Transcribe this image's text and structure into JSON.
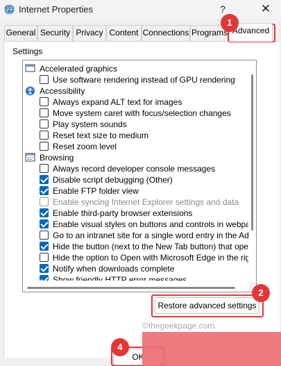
{
  "window": {
    "title": "Internet Properties",
    "help_glyph": "?",
    "close_glyph": "✕"
  },
  "tabs": [
    {
      "label": "General"
    },
    {
      "label": "Security"
    },
    {
      "label": "Privacy"
    },
    {
      "label": "Content"
    },
    {
      "label": "Connections"
    },
    {
      "label": "Programs"
    },
    {
      "label": "Advanced",
      "active": true
    }
  ],
  "settings": {
    "title": "Settings",
    "items": [
      {
        "kind": "group",
        "label": "Accelerated graphics",
        "icon": "monitor-icon"
      },
      {
        "kind": "option",
        "label": "Use software rendering instead of GPU rendering",
        "checked": false
      },
      {
        "kind": "group",
        "label": "Accessibility",
        "icon": "accessibility-icon"
      },
      {
        "kind": "option",
        "label": "Always expand ALT text for images",
        "checked": false
      },
      {
        "kind": "option",
        "label": "Move system caret with focus/selection changes",
        "checked": false
      },
      {
        "kind": "option",
        "label": "Play system sounds",
        "checked": false
      },
      {
        "kind": "option",
        "label": "Reset text size to medium",
        "checked": false
      },
      {
        "kind": "option",
        "label": "Reset zoom level",
        "checked": false
      },
      {
        "kind": "group",
        "label": "Browsing",
        "icon": "browser-window-icon"
      },
      {
        "kind": "option",
        "label": "Always record developer console messages",
        "checked": false
      },
      {
        "kind": "option",
        "label": "Disable script debugging (Other)",
        "checked": true
      },
      {
        "kind": "option",
        "label": "Enable FTP folder view",
        "checked": true
      },
      {
        "kind": "option",
        "label": "Enable syncing Internet Explorer settings and data",
        "checked": false,
        "disabled": true
      },
      {
        "kind": "option",
        "label": "Enable third-party browser extensions",
        "checked": true
      },
      {
        "kind": "option",
        "label": "Enable visual styles on buttons and controls in webpages",
        "checked": true
      },
      {
        "kind": "option",
        "label": "Go to an intranet site for a single word entry in the Addres",
        "checked": false
      },
      {
        "kind": "option",
        "label": "Hide the button (next to the New Tab button) that opens",
        "checked": true
      },
      {
        "kind": "option",
        "label": "Hide the option to Open with Microsoft Edge in the right-c",
        "checked": false
      },
      {
        "kind": "option",
        "label": "Notify when downloads complete",
        "checked": true
      },
      {
        "kind": "option",
        "label": "Show friendly HTTP error messages",
        "checked": true
      }
    ]
  },
  "buttons": {
    "restore": "Restore advanced settings",
    "ok": "OK"
  },
  "annotations": {
    "badge_1": "1",
    "badge_2": "2",
    "badge_4": "4",
    "watermark": "©thegeekpage.com",
    "highlight_color": "#e23737"
  },
  "colors": {
    "checkbox_checked": "#0067c0"
  }
}
